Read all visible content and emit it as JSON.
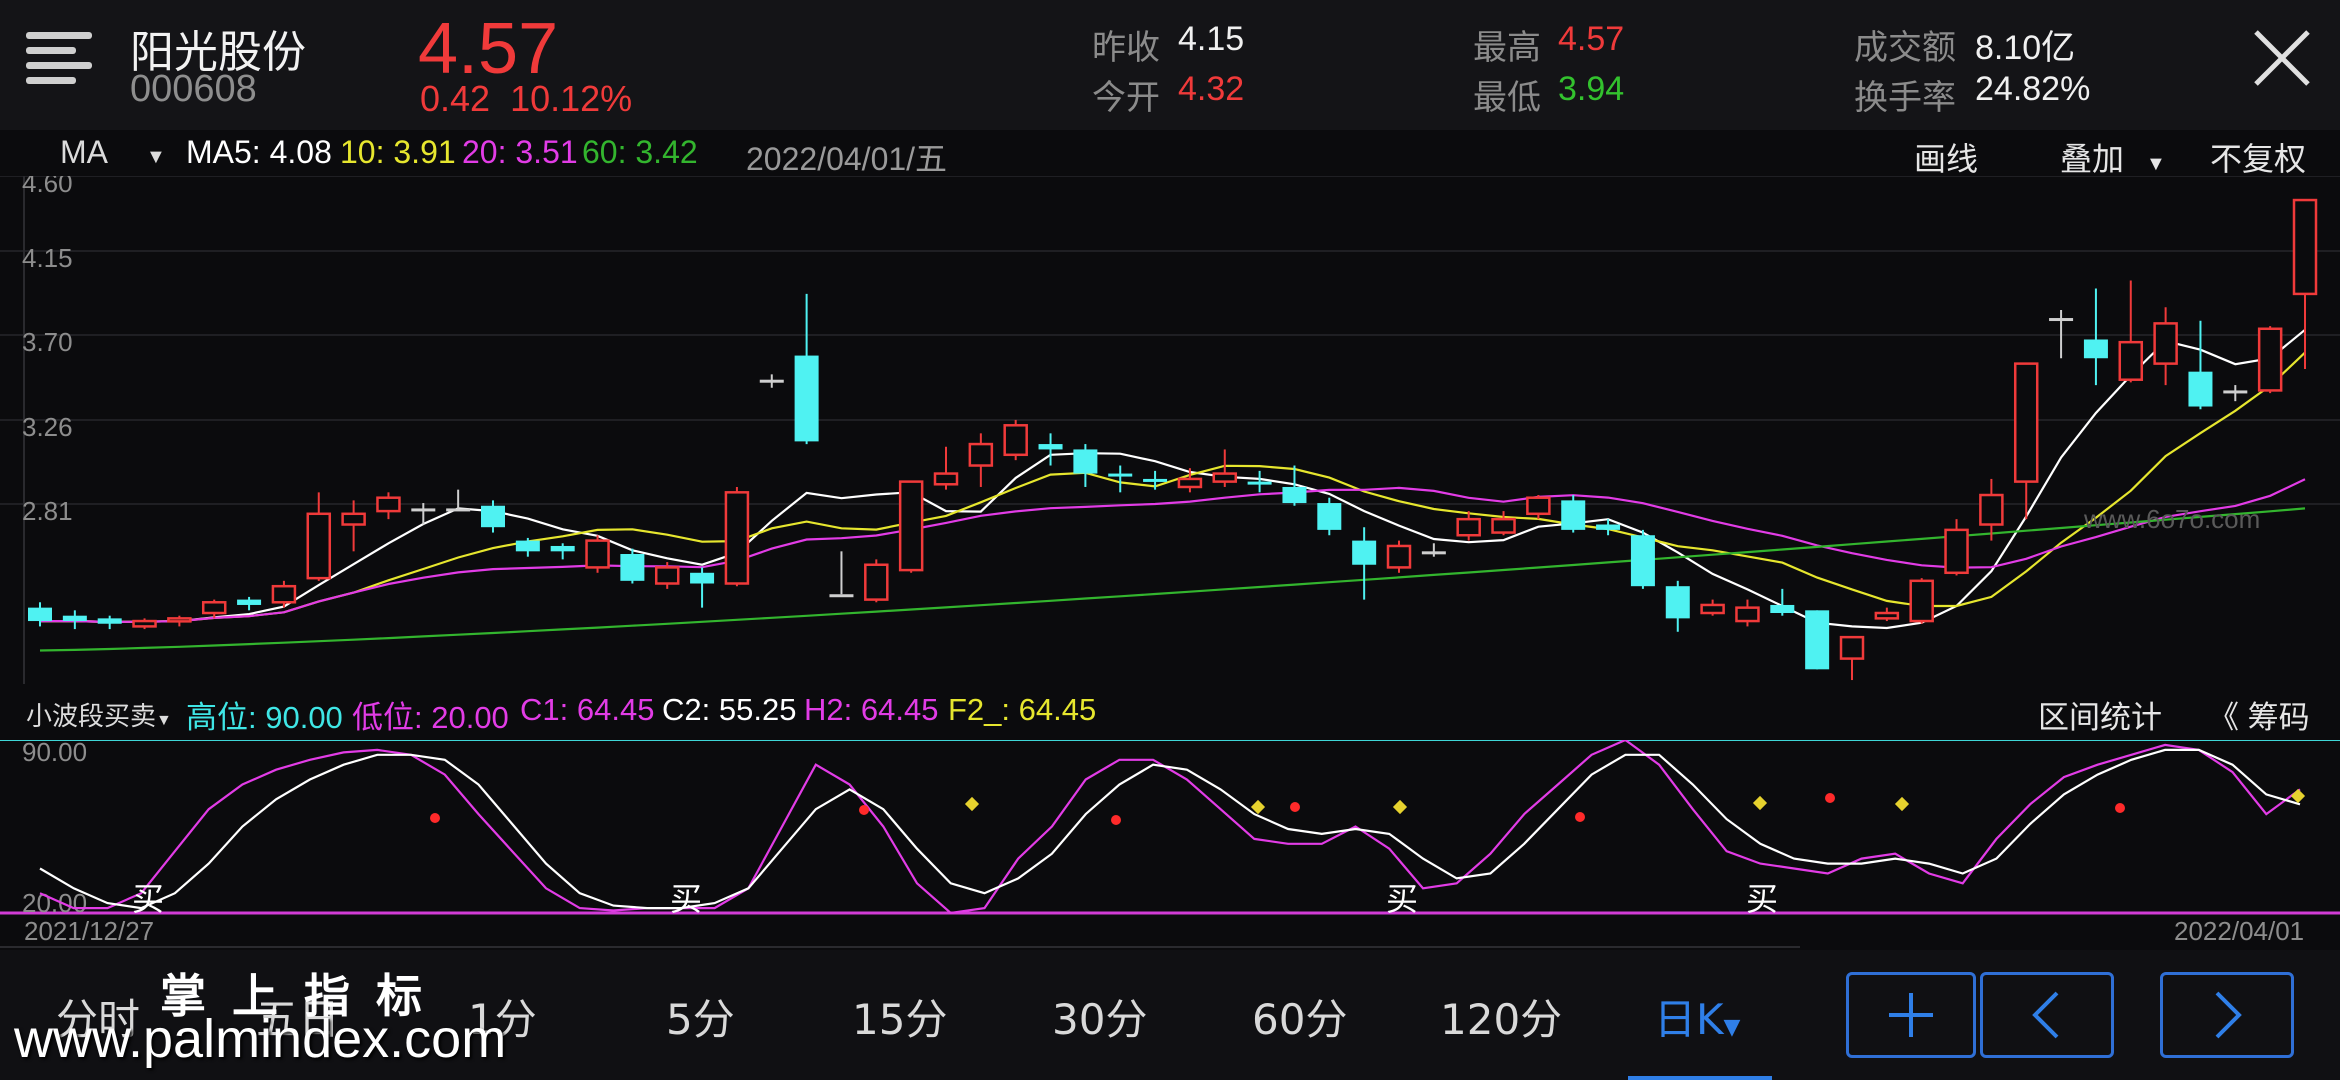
{
  "header": {
    "stock_name": "阳光股份",
    "stock_code": "000608",
    "price": "4.57",
    "change_amount": "0.42",
    "change_percent": "10.12%",
    "stats": {
      "prev_close_label": "昨收",
      "prev_close": "4.15",
      "open_label": "今开",
      "open": "4.32",
      "high_label": "最高",
      "high": "4.57",
      "low_label": "最低",
      "low": "3.94",
      "turnover_label": "成交额",
      "turnover": "8.10亿",
      "turnover_rate_label": "换手率",
      "turnover_rate": "24.82%"
    }
  },
  "ma_bar": {
    "selector": "MA",
    "ma5": "MA5: 4.08",
    "ma10": "10: 3.91",
    "ma20": "20: 3.51",
    "ma60": "60: 3.42",
    "date": "2022/04/01/五",
    "draw_label": "画线",
    "overlay_label": "叠加",
    "adjust_label": "不复权"
  },
  "price_axis": [
    "4.60",
    "4.15",
    "3.70",
    "3.26",
    "2.81"
  ],
  "indicator_bar": {
    "name": "小波段买卖",
    "high": "高位: 90.00",
    "low": "低位: 20.00",
    "c1": "C1: 64.45",
    "c2": "C2: 55.25",
    "h2": "H2: 64.45",
    "f2": "F2_: 64.45",
    "interval_label": "区间统计",
    "chips_label": "《 筹码"
  },
  "indicator_axis": {
    "top": "90.00",
    "bottom": "20.00"
  },
  "buy_label": "买",
  "date_range": {
    "start": "2021/12/27",
    "end": "2022/04/01"
  },
  "tabs": [
    "分时",
    "五日",
    "1分",
    "5分",
    "15分",
    "30分",
    "60分",
    "120分",
    "日K"
  ],
  "active_tab": "日K",
  "watermark": {
    "title": "掌上指标",
    "url": "www.palmindex.com",
    "side": "www.6o7o.com"
  },
  "colors": {
    "up": "#f03a3a",
    "down": "#4ff2f2",
    "ma5": "#ffffff",
    "ma10": "#e6e62e",
    "ma20": "#e23ce6",
    "ma60": "#33b52e",
    "accent": "#2f7fe8"
  }
}
